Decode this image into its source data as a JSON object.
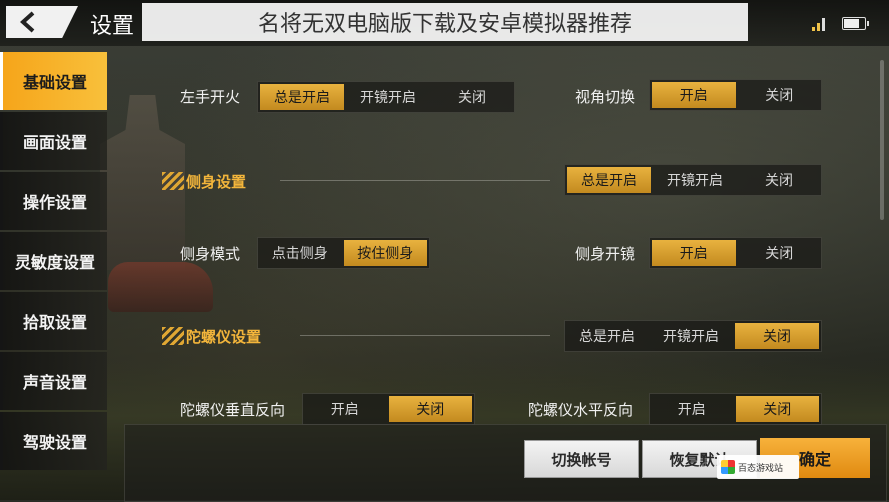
{
  "header": {
    "title": "设置",
    "overlay_caption": "名将无双电脑版下载及安卓模拟器推荐"
  },
  "sidebar": {
    "items": [
      {
        "label": "基础设置",
        "active": true
      },
      {
        "label": "画面设置"
      },
      {
        "label": "操作设置"
      },
      {
        "label": "灵敏度设置"
      },
      {
        "label": "拾取设置"
      },
      {
        "label": "声音设置"
      },
      {
        "label": "驾驶设置"
      }
    ]
  },
  "settings": {
    "left_fire": {
      "label": "左手开火",
      "options": [
        "总是开启",
        "开镜开启",
        "关闭"
      ],
      "selected": "总是开启"
    },
    "view_switch": {
      "label": "视角切换",
      "options": [
        "开启",
        "关闭"
      ],
      "selected": "开启"
    },
    "lean_section": {
      "title": "侧身设置",
      "options": [
        "总是开启",
        "开镜开启",
        "关闭"
      ],
      "selected": "总是开启"
    },
    "lean_mode": {
      "label": "侧身模式",
      "options": [
        "点击侧身",
        "按住侧身"
      ],
      "selected": "按住侧身"
    },
    "lean_scope": {
      "label": "侧身开镜",
      "options": [
        "开启",
        "关闭"
      ],
      "selected": "开启"
    },
    "gyro_section": {
      "title": "陀螺仪设置",
      "options": [
        "总是开启",
        "开镜开启",
        "关闭"
      ],
      "selected": "关闭"
    },
    "gyro_vertical": {
      "label": "陀螺仪垂直反向",
      "options": [
        "开启",
        "关闭"
      ],
      "selected": "关闭"
    },
    "gyro_horizontal": {
      "label": "陀螺仪水平反向",
      "options": [
        "开启",
        "关闭"
      ],
      "selected": "关闭"
    }
  },
  "footer": {
    "switch_account": "切换帐号",
    "restore_default": "恢复默认",
    "confirm": "确定"
  },
  "watermark": {
    "text": "百态游戏站"
  },
  "colors": {
    "accent": "#f6a51a",
    "highlight": "#e8b23f",
    "section_title": "#f3b53b"
  }
}
